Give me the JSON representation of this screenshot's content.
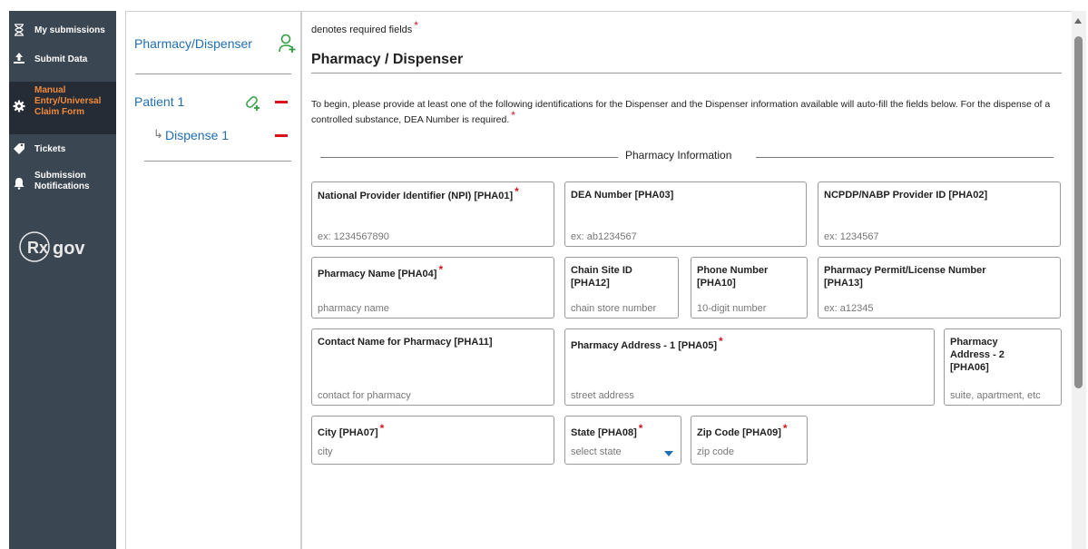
{
  "nav": {
    "items": [
      {
        "label": "My submissions",
        "icon": "hourglass-icon"
      },
      {
        "label": "Submit Data",
        "icon": "upload-icon"
      },
      {
        "label": "Manual Entry/Universal Claim Form",
        "icon": "gear-icon"
      },
      {
        "label": "Tickets",
        "icon": "ticket-icon"
      },
      {
        "label": "Submission Notifications",
        "icon": "bell-icon"
      }
    ],
    "logo": {
      "rx": "Rx",
      "gov": "gov"
    }
  },
  "tree": {
    "pharmacy": "Pharmacy/Dispenser",
    "patient": "Patient 1",
    "dispense": "Dispense 1",
    "arrow": "↳"
  },
  "form": {
    "required_note": "denotes required fields",
    "required_mark": "*",
    "title": "Pharmacy / Dispenser",
    "intro": "To begin, please provide at least one of the following identifications for the Dispenser and the Dispenser information available will auto-fill the fields below. For the dispense of a controlled substance, DEA Number is required.",
    "section": "Pharmacy Information",
    "fields": {
      "npi": {
        "label": "National Provider Identifier (NPI) [PHA01]",
        "placeholder": "ex: 1234567890"
      },
      "dea": {
        "label": "DEA Number [PHA03]",
        "placeholder": "ex: ab1234567"
      },
      "ncpdp": {
        "label": "NCPDP/NABP Provider ID [PHA02]",
        "placeholder": "ex: 1234567"
      },
      "pharm_name": {
        "label": "Pharmacy Name [PHA04]",
        "placeholder": "pharmacy name"
      },
      "chain": {
        "label": "Chain Site ID [PHA12]",
        "placeholder": "chain store number"
      },
      "phone": {
        "label": "Phone Number [PHA10]",
        "placeholder": "10-digit number"
      },
      "permit": {
        "label": "Pharmacy Permit/License Number [PHA13]",
        "placeholder": "ex: a12345"
      },
      "contact": {
        "label": "Contact Name for Pharmacy [PHA11]",
        "placeholder": "contact for pharmacy"
      },
      "addr1": {
        "label": "Pharmacy Address - 1 [PHA05]",
        "placeholder": "street address"
      },
      "addr2": {
        "label": "Pharmacy Address - 2 [PHA06]",
        "placeholder": "suite, apartment, etc"
      },
      "city": {
        "label": "City [PHA07]",
        "placeholder": "city"
      },
      "state": {
        "label": "State [PHA08]",
        "placeholder": "select state"
      },
      "zip": {
        "label": "Zip Code [PHA09]",
        "placeholder": "zip code"
      }
    }
  },
  "colors": {
    "link": "#1f6fb5",
    "required": "#d9121e",
    "nav_bg": "#3b4653",
    "nav_active_text": "#f08a3c",
    "add_icon": "#2e9e3e"
  }
}
